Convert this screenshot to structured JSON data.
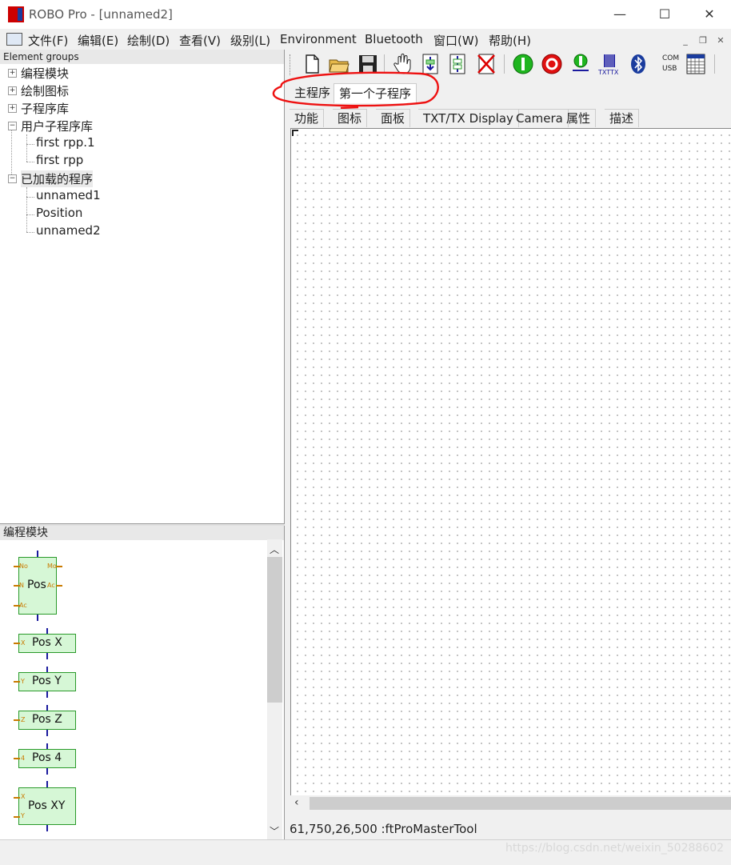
{
  "window": {
    "title": "ROBO Pro - [unnamed2]",
    "minimize": "—",
    "maximize": "☐",
    "close": "✕"
  },
  "menu": [
    "文件(F)",
    "编辑(E)",
    "绘制(D)",
    "查看(V)",
    "级别(L)",
    "Environment",
    "Bluetooth",
    "窗口(W)",
    "帮助(H)"
  ],
  "tree": {
    "header": "Element groups",
    "nodes": [
      {
        "label": "编程模块",
        "expander": "+"
      },
      {
        "label": "绘制图标",
        "expander": "+"
      },
      {
        "label": "子程序库",
        "expander": "+"
      },
      {
        "label": "用户子程序库",
        "expander": "−"
      },
      {
        "label": "first rpp.1"
      },
      {
        "label": "first rpp"
      },
      {
        "label": "已加载的程序",
        "expander": "−"
      },
      {
        "label": "unnamed1"
      },
      {
        "label": "Position"
      },
      {
        "label": "unnamed2"
      }
    ]
  },
  "palette": {
    "header": "编程模块",
    "blocks": [
      "Pos",
      "Pos X",
      "Pos Y",
      "Pos Z",
      "Pos 4",
      "Pos XY"
    ],
    "pins": {
      "no": "No",
      "mo": "Mo",
      "n": "N",
      "ac": "Ac",
      "ac2": "Ac",
      "x": "X",
      "y": "Y",
      "z": "Z",
      "four": "4",
      "xy_x": "X",
      "xy_y": "Y"
    }
  },
  "toolbar": {
    "icons": [
      "new-file-icon",
      "open-folder-icon",
      "save-icon",
      "hand-icon",
      "download-icon",
      "single-step-icon",
      "delete-icon",
      "start-icon",
      "stop-icon",
      "online-icon",
      "txt-tx-icon",
      "bluetooth-icon",
      "com-usb-icon",
      "calculator-icon"
    ],
    "txt_label": "TXTTX",
    "com": "COM",
    "usb": "USB",
    "bt": "ʙ"
  },
  "program_tabs": [
    "主程序",
    "第一个子程序"
  ],
  "sub_tabs": [
    "功能",
    "图标",
    "面板",
    "TXT/TX Display",
    "Camera",
    "属性",
    "描述"
  ],
  "status": "61,750,26,500 :ftProMasterTool",
  "watermark": "https://blog.csdn.net/weixin_50288602",
  "colors": {
    "annotation": "#e11",
    "block_fill": "#d6f7d6",
    "wire": "#1a1a9e",
    "pin": "#c97a00"
  }
}
